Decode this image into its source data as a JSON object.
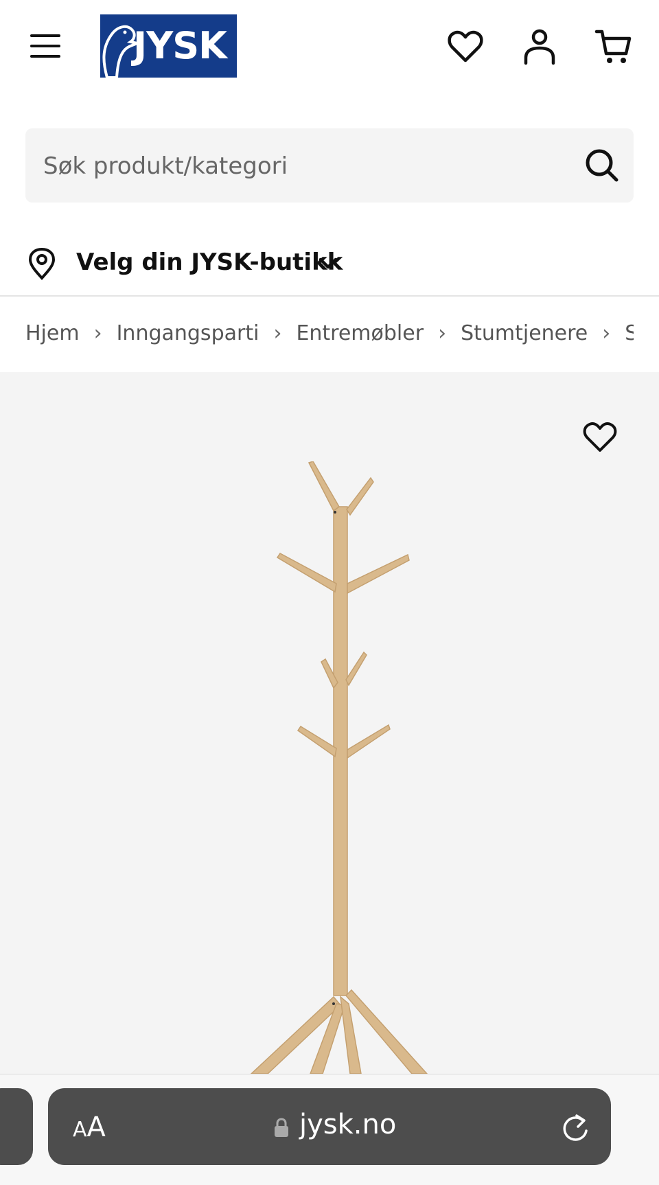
{
  "header": {
    "logo_text": "JYSK",
    "brand_color": "#143c8a"
  },
  "search": {
    "placeholder": "Søk produkt/kategori",
    "value": ""
  },
  "store": {
    "label": "Velg din JYSK-butikk"
  },
  "breadcrumb": {
    "items": [
      "Hjem",
      "Inngangsparti",
      "Entremøbler",
      "Stumtjenere",
      "Stumtjener"
    ]
  },
  "browser": {
    "aa_small": "A",
    "aa_big": "A",
    "url": "jysk.no"
  },
  "icons": {
    "menu": "hamburger-menu-icon",
    "favorites": "heart-icon",
    "account": "user-icon",
    "cart": "cart-icon",
    "search": "search-icon",
    "location": "location-pin-icon",
    "dropdown": "chevron-down-icon",
    "lock": "lock-icon",
    "reload": "reload-icon"
  }
}
